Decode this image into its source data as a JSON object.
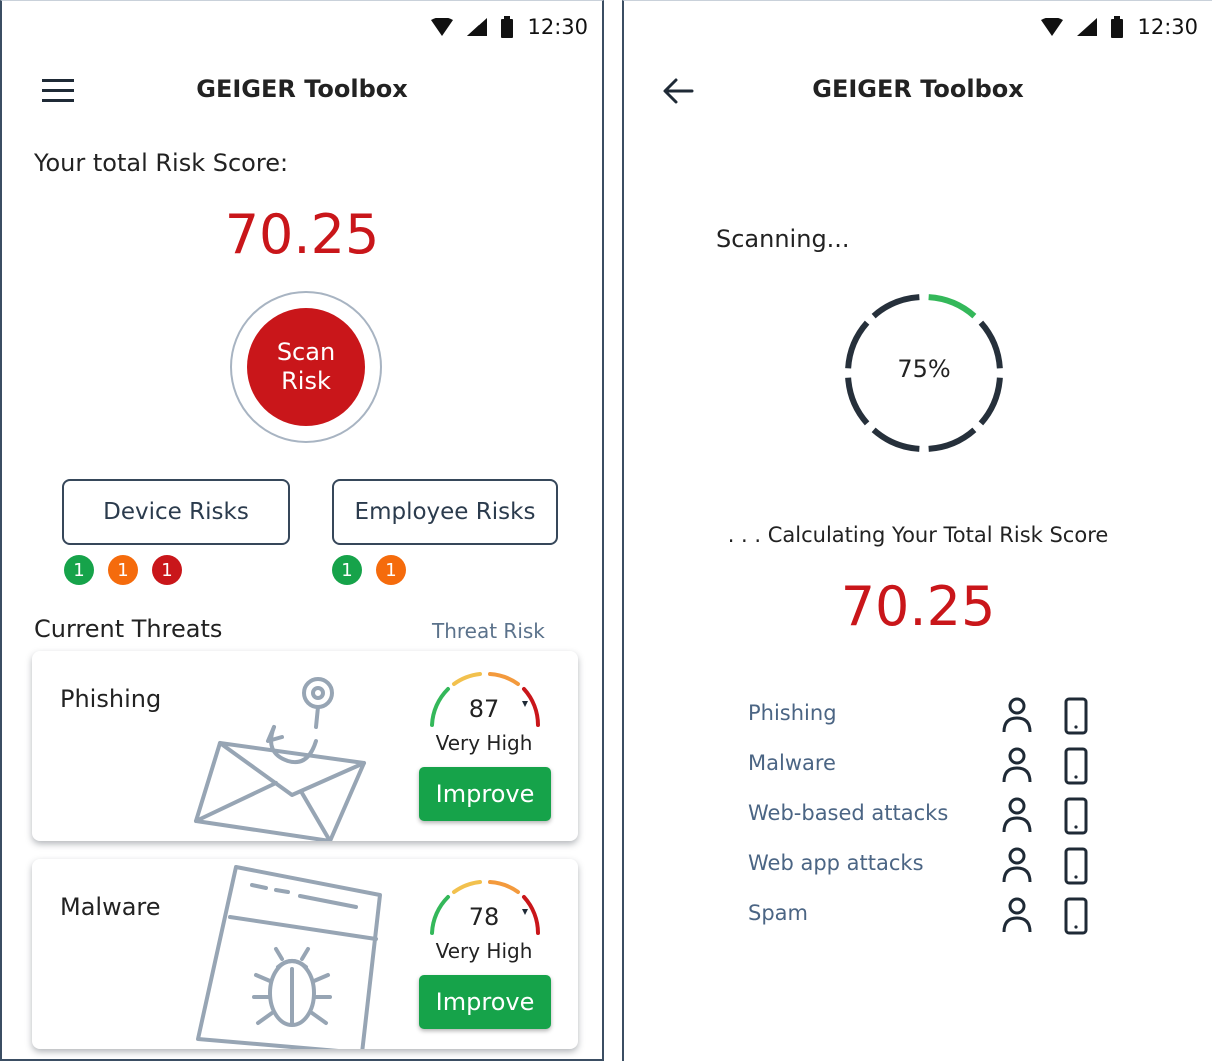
{
  "status_bar": {
    "time": "12:30"
  },
  "left_screen": {
    "app_title": "GEIGER Toolbox",
    "risk_label": "Your total Risk Score:",
    "risk_score": "70.25",
    "scan_button": {
      "line1": "Scan",
      "line2": "Risk"
    },
    "device_risks": {
      "label": "Device Risks",
      "badges": [
        "1",
        "1",
        "1"
      ]
    },
    "employee_risks": {
      "label": "Employee Risks",
      "badges": [
        "1",
        "1"
      ]
    },
    "current_threats_title": "Current Threats",
    "threat_risk_label": "Threat Risk",
    "threats": [
      {
        "name": "Phishing",
        "score": "87",
        "level": "Very High",
        "button": "Improve",
        "icon": "phishing-envelope-hook-icon"
      },
      {
        "name": "Malware",
        "score": "78",
        "level": "Very High",
        "button": "Improve",
        "icon": "malware-bug-window-icon"
      }
    ]
  },
  "right_screen": {
    "app_title": "GEIGER Toolbox",
    "scan_status": "Scanning...",
    "progress": 0.75,
    "progress_label": "75%",
    "calculating_text": ". . . Calculating Your Total Risk Score",
    "risk_score": "70.25",
    "threat_list": [
      {
        "name": "Phishing"
      },
      {
        "name": "Malware"
      },
      {
        "name": "Web-based attacks"
      },
      {
        "name": "Web app attacks"
      },
      {
        "name": "Spam"
      }
    ]
  },
  "colors": {
    "risk_red": "#c9161a",
    "improve_green": "#16a34a",
    "badge_orange": "#f56b0c",
    "outline_slate": "#36475a"
  }
}
